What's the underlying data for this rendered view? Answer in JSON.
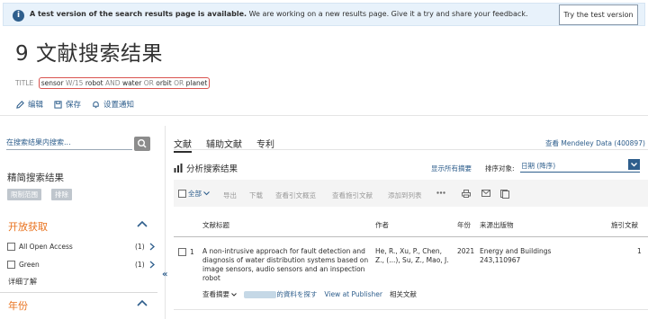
{
  "banner": {
    "bold": "A test version of the search results page is available.",
    "rest": "We are working on a new results page. Give it a try and share your feedback.",
    "button": "Try the test version"
  },
  "page_title": "9 文献搜索结果",
  "query": {
    "label": "TITLE",
    "terms": [
      "sensor",
      "W/15",
      "robot",
      "AND",
      "water",
      "OR",
      "orbit",
      "OR",
      "planet"
    ]
  },
  "actions": {
    "edit": "编辑",
    "save": "保存",
    "alert": "设置通知"
  },
  "sidebar": {
    "search_placeholder": "在搜索结果内搜索...",
    "refine_title": "精简搜索结果",
    "limit_to": "限制范围",
    "exclude": "排除",
    "open_access": {
      "title": "开放获取",
      "items": [
        {
          "label": "All Open Access",
          "count": "(1)"
        },
        {
          "label": "Green",
          "count": "(1)"
        }
      ],
      "more": "详细了解"
    },
    "year_title": "年份"
  },
  "tabs": [
    "文献",
    "辅助文献",
    "专利"
  ],
  "mendeley": "查看 Mendeley Data (400897)",
  "analyze": "分析搜索结果",
  "show_abstracts": "显示所有摘要",
  "sort": {
    "label": "排序对象:",
    "value": "日期 (降序)"
  },
  "toolbar": {
    "all": "全部",
    "export": "导出",
    "download": "下载",
    "citation_overview": "查看引文概览",
    "cited_by": "查看施引文献",
    "add_to_list": "添加到列表"
  },
  "table": {
    "headers": {
      "title": "文献标题",
      "authors": "作者",
      "year": "年份",
      "source": "来源出版物",
      "cited": "施引文献"
    },
    "rows": [
      {
        "num": "1",
        "title": "A non-intrusive approach for fault detection and diagnosis of water distribution systems based on image sensors, audio sensors and an inspection robot",
        "authors": "He, R., Xu, P., Chen, Z., (...), Su, Z., Mao, J.",
        "year": "2021",
        "source_name": "Energy and Buildings",
        "source_detail": "243,110967",
        "cited": "1",
        "view_abstract": "查看摘要",
        "find_text": "的資料を探す",
        "view_publisher": "View at Publisher",
        "related": "相关文献"
      }
    ]
  }
}
